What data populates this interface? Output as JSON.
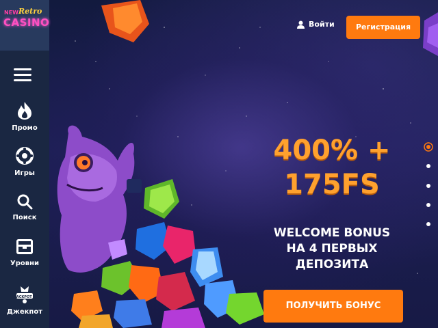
{
  "logo": {
    "new": "NEW",
    "retro": "Retro",
    "casino": "CASINO"
  },
  "header": {
    "login_label": "Войти",
    "register_label": "Регистрация"
  },
  "sidebar": {
    "items": [
      {
        "label": "Промо",
        "icon": "fire-icon"
      },
      {
        "label": "Игры",
        "icon": "roulette-icon"
      },
      {
        "label": "Поиск",
        "icon": "search-icon"
      },
      {
        "label": "Уровни",
        "icon": "chest-icon"
      },
      {
        "label": "Джекпот",
        "icon": "jackpot-icon",
        "badge": "JACKPOT"
      }
    ]
  },
  "hero": {
    "headline_line1": "400% +",
    "headline_line2": "175FS",
    "sub_line1": "WELCOME BONUS",
    "sub_line2": "НА 4 ПЕРВЫХ",
    "sub_line3": "ДЕПОЗИТА",
    "cta_label": "ПОЛУЧИТЬ БОНУС",
    "slide_count": 5,
    "active_slide": 1
  },
  "colors": {
    "accent": "#ff7a0f",
    "headline": "#ffa12e",
    "sidebar": "#1a2742"
  }
}
